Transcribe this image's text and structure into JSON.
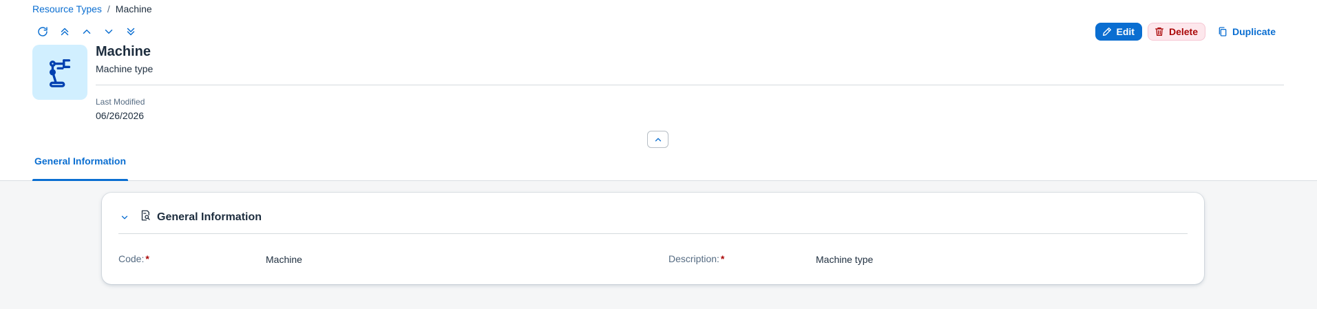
{
  "breadcrumb": {
    "parent": "Resource Types",
    "separator": "/",
    "current": "Machine"
  },
  "toolbar": {
    "edit_label": "Edit",
    "delete_label": "Delete",
    "duplicate_label": "Duplicate"
  },
  "object": {
    "title": "Machine",
    "subtitle": "Machine type",
    "last_modified_label": "Last Modified",
    "last_modified_value": "06/26/2026"
  },
  "tabs": [
    {
      "label": "General Information",
      "selected": true
    }
  ],
  "section": {
    "title": "General Information",
    "fields": [
      {
        "label": "Code:",
        "required_mark": "*",
        "value": "Machine"
      },
      {
        "label": "Description:",
        "required_mark": "*",
        "value": "Machine type"
      }
    ]
  },
  "colors": {
    "accent": "#0a6ed1",
    "negative": "#aa0808",
    "avatar_bg": "#d1efff"
  }
}
